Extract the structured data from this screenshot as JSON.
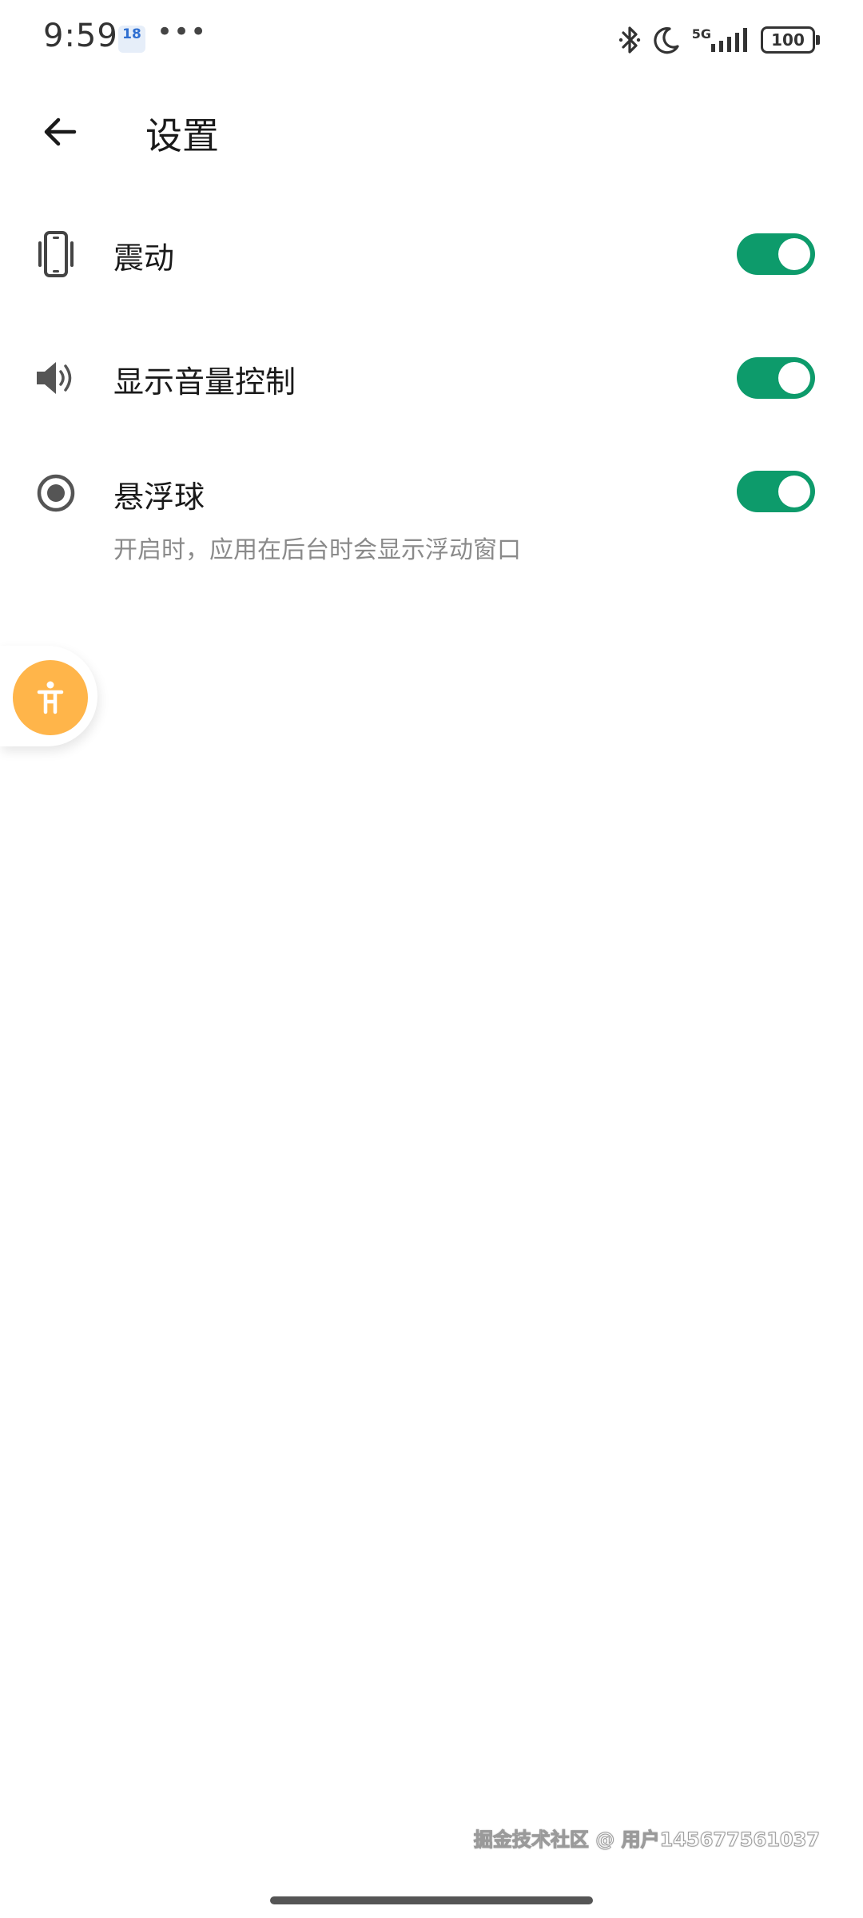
{
  "status_bar": {
    "time": "9:59",
    "date_badge": "18",
    "more_dots": "•••",
    "signal_label": "5G",
    "battery": "100",
    "icons": [
      "bluetooth-icon",
      "moon-icon",
      "signal-icon",
      "battery-icon"
    ]
  },
  "header": {
    "title": "设置",
    "back_icon": "arrow-left-icon"
  },
  "settings": [
    {
      "label": "震动",
      "icon": "vibrate-phone-icon",
      "enabled": true
    },
    {
      "label": "显示音量控制",
      "icon": "speaker-icon",
      "enabled": true
    },
    {
      "label": "悬浮球",
      "icon": "radio-dot-icon",
      "enabled": true,
      "description": "开启时，应用在后台时会显示浮动窗口"
    }
  ],
  "floating_ball": {
    "icon": "accessibility-icon",
    "color": "#ffb54a"
  },
  "watermark": "掘金技术社区 @ 用户145677561037",
  "colors": {
    "toggle_on": "#0d9b6b",
    "accent_orange": "#ffb54a",
    "description_text": "#8a8a8a"
  }
}
